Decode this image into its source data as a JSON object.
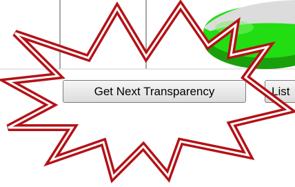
{
  "toolbar": {
    "next_label": "Get Next Transparency",
    "list_label": "List"
  },
  "colors": {
    "starburst_outline": "#b31217",
    "pie_green": "#22dd11",
    "grid_lines": "#888888"
  },
  "icons": {
    "callout": "starburst-callout-icon",
    "chart": "pie-chart-fragment"
  }
}
